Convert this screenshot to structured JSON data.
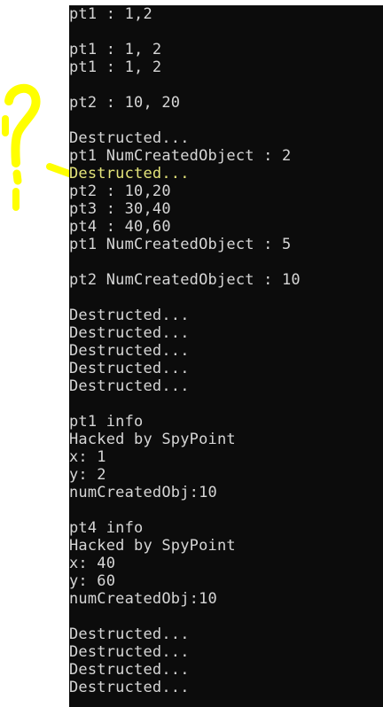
{
  "annotation": {
    "text": "?",
    "color": "#ffff00"
  },
  "console": {
    "background": "#0c0c0c",
    "foreground": "#d6d6d6",
    "highlight_color": "#e4e47a",
    "lines": [
      {
        "text": "pt1 : 1,2",
        "highlight": false
      },
      {
        "text": "",
        "highlight": false
      },
      {
        "text": "pt1 : 1, 2",
        "highlight": false
      },
      {
        "text": "pt1 : 1, 2",
        "highlight": false
      },
      {
        "text": "",
        "highlight": false
      },
      {
        "text": "pt2 : 10, 20",
        "highlight": false
      },
      {
        "text": "",
        "highlight": false
      },
      {
        "text": "Destructed...",
        "highlight": false
      },
      {
        "text": "pt1 NumCreatedObject : 2",
        "highlight": false
      },
      {
        "text": "Destructed...",
        "highlight": true
      },
      {
        "text": "pt2 : 10,20",
        "highlight": false
      },
      {
        "text": "pt3 : 30,40",
        "highlight": false
      },
      {
        "text": "pt4 : 40,60",
        "highlight": false
      },
      {
        "text": "pt1 NumCreatedObject : 5",
        "highlight": false
      },
      {
        "text": "",
        "highlight": false
      },
      {
        "text": "pt2 NumCreatedObject : 10",
        "highlight": false
      },
      {
        "text": "",
        "highlight": false
      },
      {
        "text": "Destructed...",
        "highlight": false
      },
      {
        "text": "Destructed...",
        "highlight": false
      },
      {
        "text": "Destructed...",
        "highlight": false
      },
      {
        "text": "Destructed...",
        "highlight": false
      },
      {
        "text": "Destructed...",
        "highlight": false
      },
      {
        "text": "",
        "highlight": false
      },
      {
        "text": "pt1 info",
        "highlight": false
      },
      {
        "text": "Hacked by SpyPoint",
        "highlight": false
      },
      {
        "text": "x: 1",
        "highlight": false
      },
      {
        "text": "y: 2",
        "highlight": false
      },
      {
        "text": "numCreatedObj:10",
        "highlight": false
      },
      {
        "text": "",
        "highlight": false
      },
      {
        "text": "pt4 info",
        "highlight": false
      },
      {
        "text": "Hacked by SpyPoint",
        "highlight": false
      },
      {
        "text": "x: 40",
        "highlight": false
      },
      {
        "text": "y: 60",
        "highlight": false
      },
      {
        "text": "numCreatedObj:10",
        "highlight": false
      },
      {
        "text": "",
        "highlight": false
      },
      {
        "text": "Destructed...",
        "highlight": false
      },
      {
        "text": "Destructed...",
        "highlight": false
      },
      {
        "text": "Destructed...",
        "highlight": false
      },
      {
        "text": "Destructed...",
        "highlight": false
      }
    ]
  }
}
